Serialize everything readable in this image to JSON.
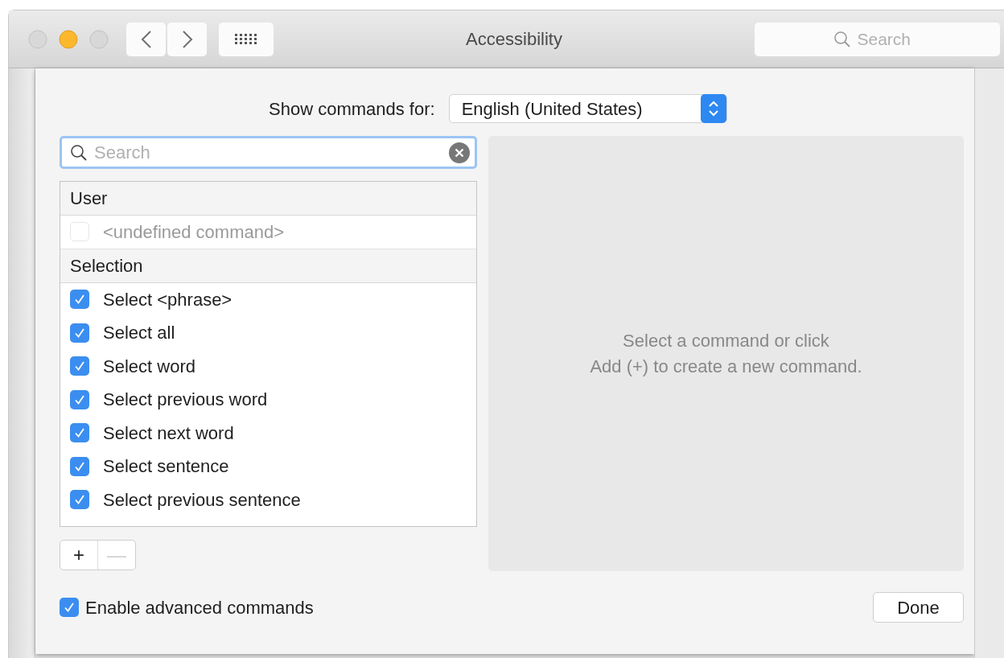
{
  "window": {
    "title": "Accessibility",
    "search": {
      "placeholder": "Search"
    }
  },
  "language": {
    "label": "Show commands for:",
    "value": "English (United States)"
  },
  "command_search": {
    "placeholder": "Search"
  },
  "commands": [
    {
      "kind": "header",
      "label": "User"
    },
    {
      "kind": "item",
      "label": "<undefined command>",
      "checked": false,
      "disabled": true
    },
    {
      "kind": "header",
      "label": "Selection"
    },
    {
      "kind": "item",
      "label": "Select <phrase>",
      "checked": true,
      "disabled": false
    },
    {
      "kind": "item",
      "label": "Select all",
      "checked": true,
      "disabled": false
    },
    {
      "kind": "item",
      "label": "Select word",
      "checked": true,
      "disabled": false
    },
    {
      "kind": "item",
      "label": "Select previous word",
      "checked": true,
      "disabled": false
    },
    {
      "kind": "item",
      "label": "Select next word",
      "checked": true,
      "disabled": false
    },
    {
      "kind": "item",
      "label": "Select sentence",
      "checked": true,
      "disabled": false
    },
    {
      "kind": "item",
      "label": "Select previous sentence",
      "checked": true,
      "disabled": false
    }
  ],
  "list_buttons": [
    {
      "label": "+",
      "disabled": false
    },
    {
      "label": "—",
      "disabled": true
    }
  ],
  "detail": {
    "message": "Select a command or click\nAdd (+) to create a new command."
  },
  "advanced": {
    "label": "Enable advanced commands",
    "checked": true
  },
  "done_button": "Done"
}
